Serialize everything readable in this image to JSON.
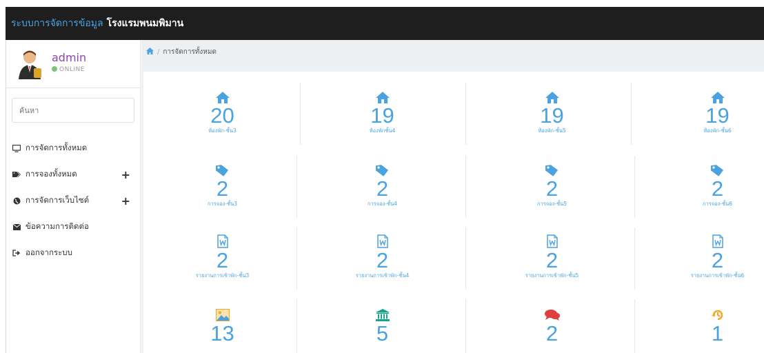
{
  "header": {
    "brand_part1": "ระบบการจัดการข้อมูล",
    "brand_part2": "โรงแรมพนมพิมาน"
  },
  "user": {
    "name": "admin",
    "status": "ONLINE"
  },
  "search": {
    "placeholder": "ค้นหา"
  },
  "menu": [
    {
      "label": "การจัดการทั้งหมด",
      "icon": "monitor-icon",
      "expandable": false
    },
    {
      "label": "การจองทั้งหมด",
      "icon": "tags-icon",
      "expandable": true
    },
    {
      "label": "การจัดการเว็บไซต์",
      "icon": "globe-icon",
      "expandable": true
    },
    {
      "label": "ข้อความการติดต่อ",
      "icon": "envelope-icon",
      "expandable": false
    },
    {
      "label": "ออกจากระบบ",
      "icon": "sign-out-icon",
      "expandable": false
    }
  ],
  "breadcrumb": {
    "current": "การจัดการทั้งหมด"
  },
  "colors": {
    "accent": "#4aa3df",
    "topbar": "#1e1e1e",
    "teal": "#17a08c",
    "red": "#e03e3e",
    "orange": "#f5a623"
  },
  "tiles": [
    {
      "icon": "home-icon",
      "value": "20",
      "label": "ห้องพัก-ชั้น3"
    },
    {
      "icon": "home-icon",
      "value": "19",
      "label": "ห้องพักชั้น4"
    },
    {
      "icon": "home-icon",
      "value": "19",
      "label": "ห้องพัก-ชั้น5"
    },
    {
      "icon": "home-icon",
      "value": "19",
      "label": "ห้องพัก-ชั้น6"
    },
    {
      "icon": "tag-icon",
      "value": "2",
      "label": "การจอง-ชั้น3"
    },
    {
      "icon": "tag-icon",
      "value": "2",
      "label": "การจอง-ชั้น4"
    },
    {
      "icon": "tag-icon",
      "value": "2",
      "label": "การจอง-ชั้น5"
    },
    {
      "icon": "tag-icon",
      "value": "2",
      "label": "การจอง-ชั้น6"
    },
    {
      "icon": "word-file-icon",
      "value": "2",
      "label": "รายงานการเข้าพัก-ชั้น3"
    },
    {
      "icon": "word-file-icon",
      "value": "2",
      "label": "รายงานการเข้าพัก-ชั้น4"
    },
    {
      "icon": "word-file-icon",
      "value": "2",
      "label": "รายงานการเข้าพัก-ชั้น5"
    },
    {
      "icon": "word-file-icon",
      "value": "2",
      "label": "รายงานการเข้าพัก-ชั้น6"
    },
    {
      "icon": "image-icon",
      "value": "13",
      "label": ""
    },
    {
      "icon": "bank-icon",
      "value": "5",
      "label": ""
    },
    {
      "icon": "comments-icon",
      "value": "2",
      "label": ""
    },
    {
      "icon": "history-icon",
      "value": "1",
      "label": ""
    }
  ]
}
